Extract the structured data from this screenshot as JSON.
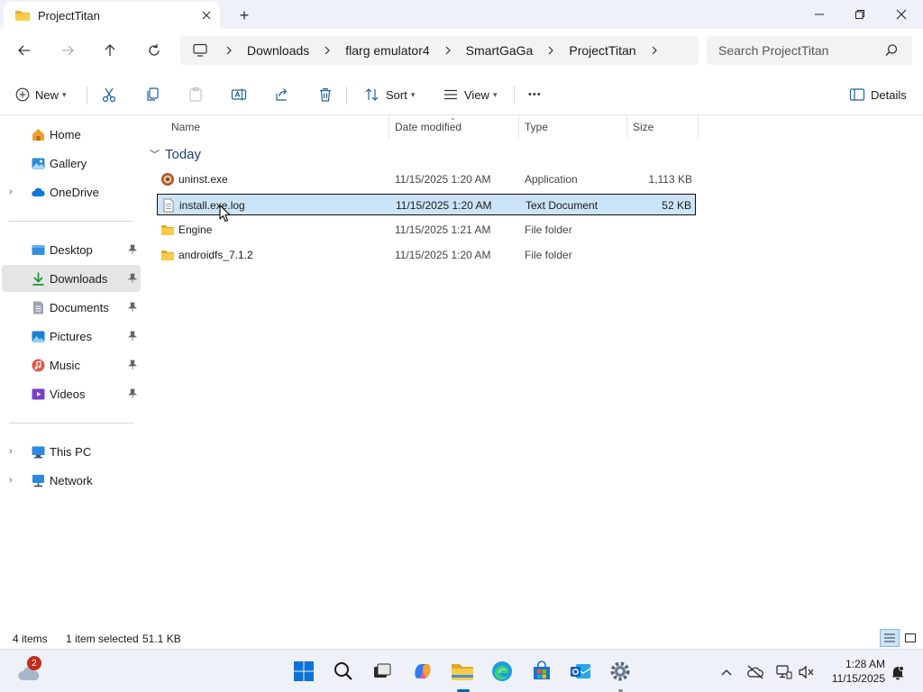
{
  "window": {
    "tab_title": "ProjectTitan",
    "new_tab_symbol": "+"
  },
  "addressbar": {
    "breadcrumb": [
      "Downloads",
      "flarg emulator4",
      "SmartGaGa",
      "ProjectTitan"
    ],
    "search_placeholder": "Search ProjectTitan"
  },
  "commandbar": {
    "new_label": "New",
    "sort_label": "Sort",
    "view_label": "View",
    "details_label": "Details",
    "more_symbol": "•••"
  },
  "sidebar": {
    "items": [
      {
        "label": "Home"
      },
      {
        "label": "Gallery"
      },
      {
        "label": "OneDrive"
      },
      {
        "label": "Desktop"
      },
      {
        "label": "Downloads"
      },
      {
        "label": "Documents"
      },
      {
        "label": "Pictures"
      },
      {
        "label": "Music"
      },
      {
        "label": "Videos"
      },
      {
        "label": "This PC"
      },
      {
        "label": "Network"
      }
    ],
    "selected": "Downloads"
  },
  "filelist": {
    "columns": {
      "name": "Name",
      "date": "Date modified",
      "type": "Type",
      "size": "Size"
    },
    "group": "Today",
    "rows": [
      {
        "name": "uninst.exe",
        "date": "11/15/2025 1:20 AM",
        "type": "Application",
        "size": "1,113 KB",
        "icon": "application-icon"
      },
      {
        "name": "install.exe.log",
        "date": "11/15/2025 1:20 AM",
        "type": "Text Document",
        "size": "52 KB",
        "icon": "text-document-icon",
        "selected": true
      },
      {
        "name": "Engine",
        "date": "11/15/2025 1:21 AM",
        "type": "File folder",
        "size": "",
        "icon": "folder-icon"
      },
      {
        "name": "androidfs_7.1.2",
        "date": "11/15/2025 1:20 AM",
        "type": "File folder",
        "size": "",
        "icon": "folder-icon"
      }
    ]
  },
  "statusbar": {
    "item_count": "4 items",
    "selection": "1 item selected",
    "selection_size": "51.1 KB"
  },
  "taskbar": {
    "weather_badge": "2",
    "time": "1:28 AM",
    "date": "11/15/2025"
  },
  "colors": {
    "accent": "#0067c0",
    "selection": "#cce4f7",
    "folder": "#f4c542",
    "group_header": "#1d3f73"
  }
}
